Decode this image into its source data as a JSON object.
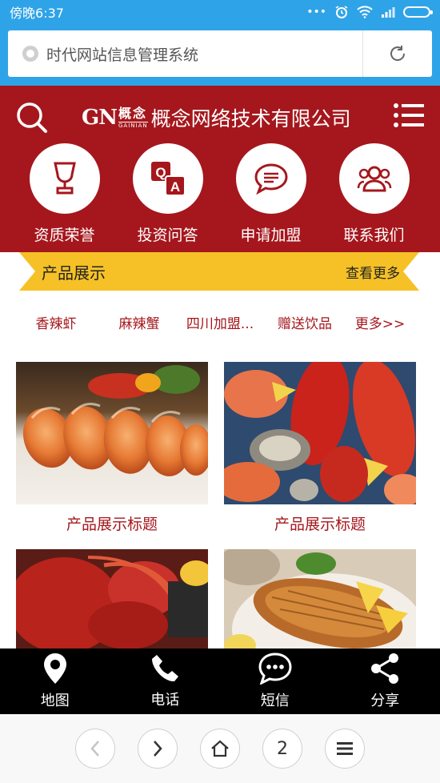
{
  "status_bar": {
    "time": "傍晚6:37",
    "dots": "•••"
  },
  "browser": {
    "url_text": "时代网站信息管理系统"
  },
  "header": {
    "logo_gn": "GN",
    "logo_mark_cn": "概念",
    "logo_mark_en": "GAINIAN",
    "company_name": "概念网络技术有限公司"
  },
  "quick_nav": [
    {
      "label": "资质荣誉",
      "icon": "trophy-icon"
    },
    {
      "label": "投资问答",
      "icon": "qa-icon"
    },
    {
      "label": "申请加盟",
      "icon": "chat-bubble-icon"
    },
    {
      "label": "联系我们",
      "icon": "contacts-icon"
    }
  ],
  "product_section": {
    "title": "产品展示",
    "more_label": "查看更多"
  },
  "categories": [
    "香辣虾",
    "麻辣蟹",
    "四川加盟...",
    "赠送饮品",
    "更多>>"
  ],
  "products": [
    {
      "title": "产品展示标题",
      "image": "shrimp-photo"
    },
    {
      "title": "产品展示标题",
      "image": "seafood-platter-photo"
    },
    {
      "title": "",
      "image": "lobster-photo"
    },
    {
      "title": "",
      "image": "grilled-fish-photo"
    }
  ],
  "action_bar": [
    {
      "label": "地图",
      "icon": "map-pin-icon"
    },
    {
      "label": "电话",
      "icon": "phone-icon"
    },
    {
      "label": "短信",
      "icon": "sms-icon"
    },
    {
      "label": "分享",
      "icon": "share-icon"
    }
  ],
  "browser_nav": {
    "tab_count": "2"
  },
  "colors": {
    "brand_red": "#a5171d",
    "banner_yellow": "#f5c126",
    "status_blue": "#2fa3e8"
  }
}
